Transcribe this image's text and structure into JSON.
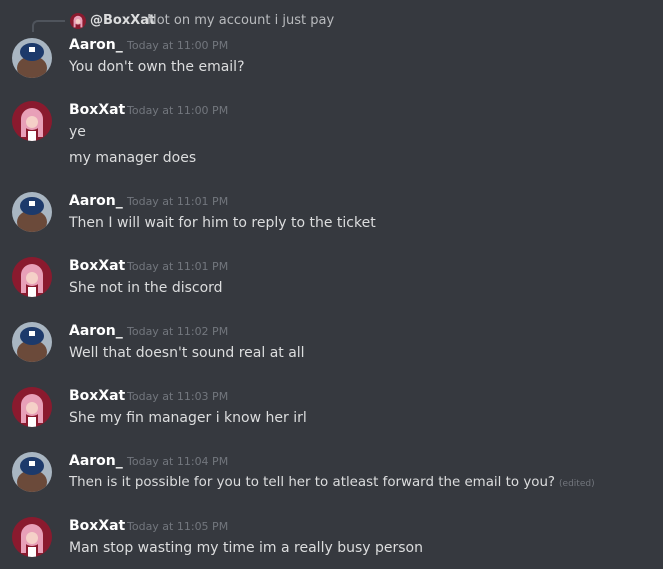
{
  "reply": {
    "author": "@BoxXat",
    "text": "Not on my account i just pay",
    "avatar_icon": "anime-girl-avatar"
  },
  "messages": [
    {
      "author": "Aaron_",
      "timestamp": "Today at 11:00 PM",
      "avatar_icon": "blue-helmet-bear-avatar",
      "lines": [
        "You don't own the email?"
      ]
    },
    {
      "author": "BoxXat",
      "timestamp": "Today at 11:00 PM",
      "avatar_icon": "anime-girl-avatar",
      "lines": [
        "ye",
        "my manager does"
      ]
    },
    {
      "author": "Aaron_",
      "timestamp": "Today at 11:01 PM",
      "avatar_icon": "blue-helmet-bear-avatar",
      "lines": [
        "Then I will wait for him to reply to the ticket"
      ]
    },
    {
      "author": "BoxXat",
      "timestamp": "Today at 11:01 PM",
      "avatar_icon": "anime-girl-avatar",
      "lines": [
        "She not in the discord"
      ]
    },
    {
      "author": "Aaron_",
      "timestamp": "Today at 11:02 PM",
      "avatar_icon": "blue-helmet-bear-avatar",
      "lines": [
        "Well that doesn't sound real at all"
      ]
    },
    {
      "author": "BoxXat",
      "timestamp": "Today at 11:03 PM",
      "avatar_icon": "anime-girl-avatar",
      "lines": [
        "She my fin manager i know her irl"
      ]
    },
    {
      "author": "Aaron_",
      "timestamp": "Today at 11:04 PM",
      "avatar_icon": "blue-helmet-bear-avatar",
      "lines": [
        "Then is it possible for you to tell her to atleast forward the email to you?"
      ],
      "edited": "(edited)"
    },
    {
      "author": "BoxXat",
      "timestamp": "Today at 11:05 PM",
      "avatar_icon": "anime-girl-avatar",
      "lines": [
        "Man stop wasting my time im a really busy person"
      ]
    }
  ],
  "colors": {
    "background": "#36393f",
    "username": "#ffffff",
    "message_text": "#dcddde",
    "timestamp": "#72767d"
  }
}
